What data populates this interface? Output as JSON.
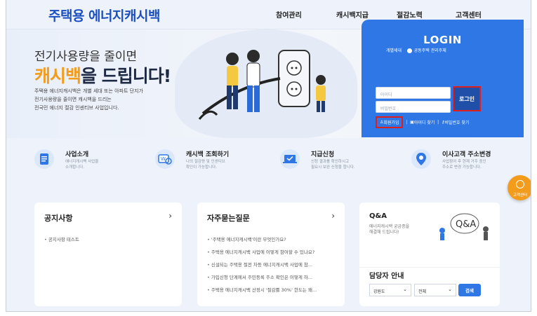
{
  "header": {
    "logo": "주택용 에너지캐시백",
    "nav": [
      "참여관리",
      "캐시백지급",
      "절감노력",
      "고객센터"
    ]
  },
  "hero": {
    "line1": "전기사용량을 줄이면",
    "line2_highlight": "캐시백",
    "line2_rest": "을 드립니다!",
    "desc": [
      "주택용 에너지캐시백은 개별 세대 또는 아파트 단지가",
      "전기사용량을 줄이면 캐시백을 드리는",
      "전국민 에너지 절감 인센티브 사업입니다."
    ]
  },
  "login": {
    "title": "LOGIN",
    "radio1": "개별세대",
    "radio2": "공동주택 관리주체",
    "id_placeholder": "아이디",
    "pw_placeholder": "비밀번호",
    "login_button": "로그인",
    "join": "회원가입",
    "find_id": "아이디 찾기",
    "find_pw": "비밀번호 찾기"
  },
  "services": [
    {
      "title": "사업소개",
      "desc": [
        "에너지캐시백 사업을",
        "소개합니다."
      ]
    },
    {
      "title": "캐시백 조회하기",
      "desc": [
        "나의 절감량 및 인센티브",
        "확인이 가능합니다."
      ]
    },
    {
      "title": "지급신청",
      "desc": [
        "신청 결과를 확인하시고",
        "필요시 보완 신청을 합니다."
      ]
    },
    {
      "title": "이사고객 주소변경",
      "desc": [
        "사업참여 후 현재 거주 중인",
        "주소로 변경 가능합니다."
      ]
    }
  ],
  "notice": {
    "title": "공지사항",
    "items": [
      "공지사항 테스트"
    ]
  },
  "faq": {
    "title": "자주묻는질문",
    "items": [
      "'주택용 에너지캐시백'이란 무엇인가요?",
      "주택용 에너지캐시백 사업에 어떻게 참여할 수 있나요?",
      "신설되는 주택용 절전 차등 에너지캐시백 사업에 참...",
      "가입신청 단계에서 주민등록 주소 확인은 어떻게 하...",
      "주택용 에너지캐시백 산정시 '절감률 30%' 한도는 왜..."
    ]
  },
  "qa": {
    "title": "Q&A",
    "desc": [
      "에너지캐시백 궁금증을",
      "해결해 드립니다!"
    ]
  },
  "manager": {
    "title": "담당자 안내",
    "region": "강원도",
    "type": "전체",
    "search": "검색"
  },
  "float": {
    "label": "고객센터"
  },
  "colors": {
    "accent": "#2f77e4",
    "highlight": "#f39c1c",
    "logo": "#1b4fbf",
    "annotation": "#e01e1e"
  }
}
